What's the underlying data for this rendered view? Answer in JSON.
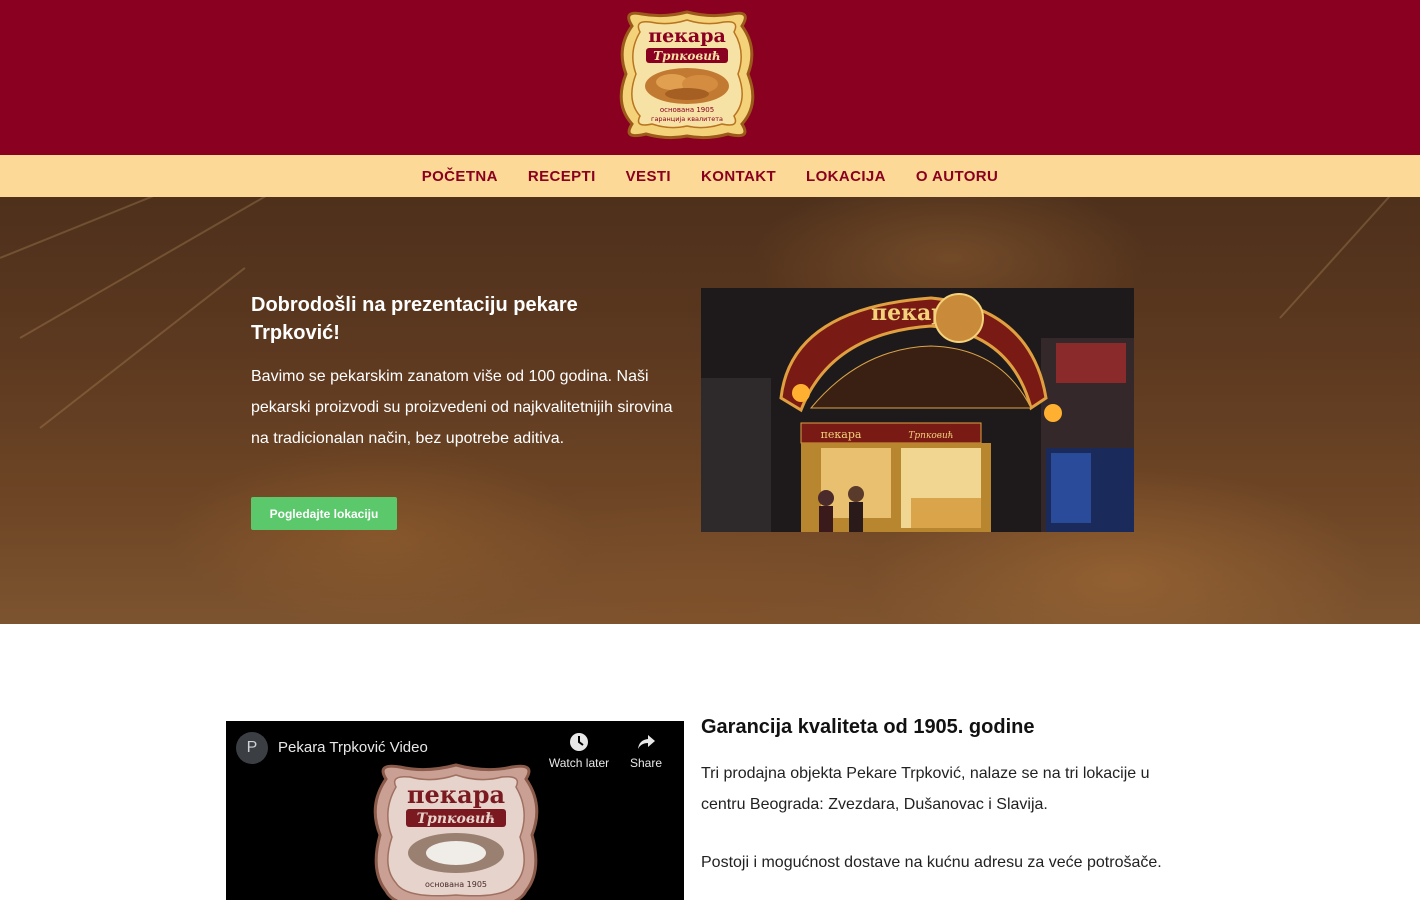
{
  "header": {
    "logo_text_top": "пекара",
    "logo_text_name": "Трпковић",
    "logo_text_bottom": "основана 1905",
    "logo_text_bottom2": "гаранција квалитета"
  },
  "nav": {
    "items": [
      {
        "label": "POČETNA"
      },
      {
        "label": "RECEPTI"
      },
      {
        "label": "VESTI"
      },
      {
        "label": "KONTAKT"
      },
      {
        "label": "LOKACIJA"
      },
      {
        "label": "O AUTORU"
      }
    ]
  },
  "hero": {
    "title": "Dobrodošli na prezentaciju pekare Trpković!",
    "text": "Bavimo se pekarskim zanatom više od 100 godina. Naši pekarski proizvodi su proizvedeni od najkvalitetnijih sirovina na tradicionalan način, bez upotrebe aditiva.",
    "button_label": "Pogledajte lokaciju",
    "photo_sign_text": "пекара",
    "photo_sign_small": "пекара",
    "photo_sign_name": "Трпковић"
  },
  "video": {
    "avatar_letter": "P",
    "title": "Pekara Trpković Video",
    "watch_later_label": "Watch later",
    "share_label": "Share",
    "logo_text_top": "пекара",
    "logo_text_name": "Трпковић",
    "logo_text_bottom": "основана 1905"
  },
  "section": {
    "title": "Garancija kvaliteta od 1905. godine",
    "paragraph1": "Tri prodajna objekta Pekare Trpković, nalaze se na tri lokacije u centru Beograda: Zvezdara, Dušanovac i Slavija.",
    "paragraph2": "Postoji i mogućnost dostave na kućnu adresu za veće potrošače."
  },
  "colors": {
    "header_bg": "#8a0020",
    "nav_bg": "#fcd996",
    "nav_text": "#8a0020",
    "button_bg": "#5bc86b"
  }
}
